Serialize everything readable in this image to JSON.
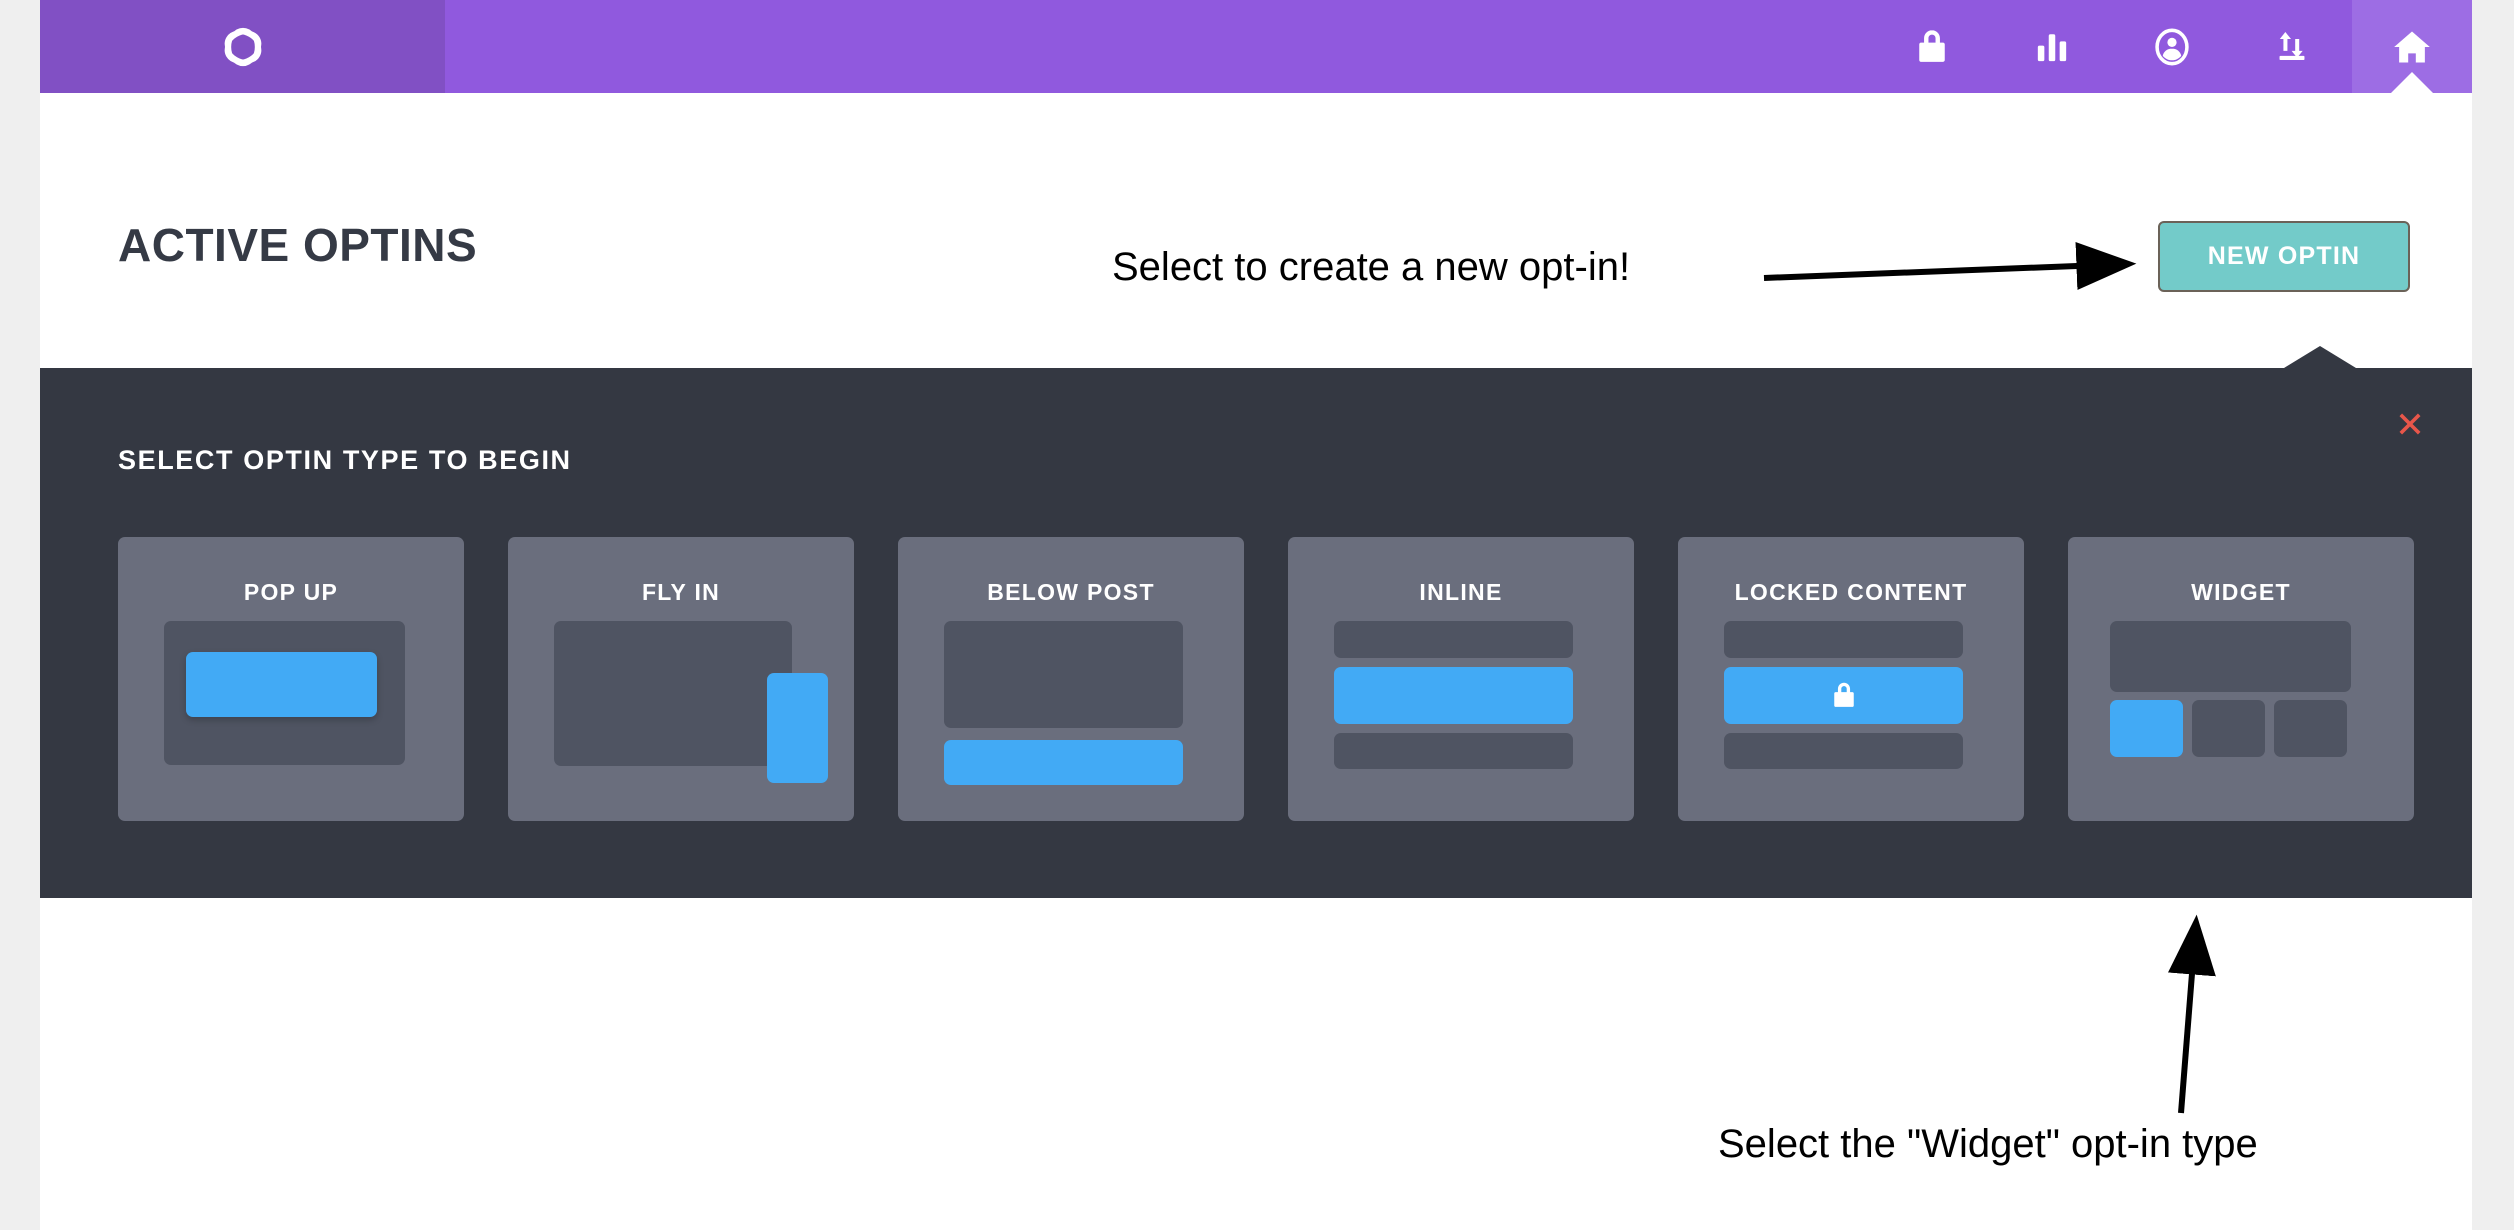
{
  "topnav": {
    "logo_icon": "interlocking-circles-logo",
    "items": [
      {
        "icon": "lock-icon",
        "name": "nav-lock",
        "active": false
      },
      {
        "icon": "bar-chart-icon",
        "name": "nav-stats",
        "active": false
      },
      {
        "icon": "user-circle-icon",
        "name": "nav-account",
        "active": false
      },
      {
        "icon": "import-export-icon",
        "name": "nav-import-export",
        "active": false
      },
      {
        "icon": "home-icon",
        "name": "nav-home",
        "active": true
      }
    ]
  },
  "page": {
    "title": "ACTIVE OPTINS",
    "new_optin_label": "NEW OPTIN"
  },
  "panel": {
    "title": "SELECT OPTIN TYPE TO BEGIN",
    "close_icon": "close-x-icon",
    "cards": [
      {
        "label": "POP UP",
        "key": "popup"
      },
      {
        "label": "FLY IN",
        "key": "flyin"
      },
      {
        "label": "BELOW POST",
        "key": "below-post"
      },
      {
        "label": "INLINE",
        "key": "inline"
      },
      {
        "label": "LOCKED CONTENT",
        "key": "locked-content",
        "icon": "lock-icon"
      },
      {
        "label": "WIDGET",
        "key": "widget"
      }
    ]
  },
  "annotations": [
    {
      "text": "Select to create a new opt-in!",
      "arrow": "right-arrow-to-new-optin-button"
    },
    {
      "text": "Select the \"Widget\" opt-in type",
      "arrow": "up-arrow-to-widget-card"
    }
  ],
  "colors": {
    "nav_purple": "#9059de",
    "logo_purple": "#8150c4",
    "nav_active_purple": "#9d6de4",
    "panel_dark": "#343842",
    "card_gray": "#6a6e7d",
    "card_inner_dark": "#4f5462",
    "accent_blue": "#42aaf5",
    "button_teal": "#73cbc9",
    "close_red": "#e8564a",
    "heading_dark": "#353a45",
    "desktop_gray": "#efefef"
  }
}
